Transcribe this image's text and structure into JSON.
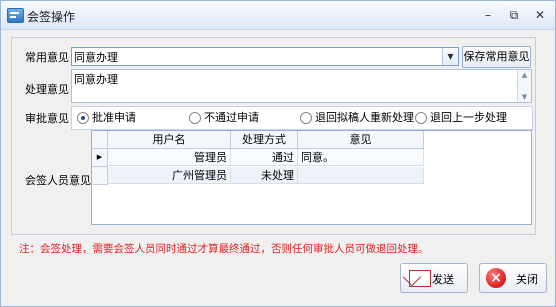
{
  "window": {
    "title": "会签操作",
    "buttons": {
      "minimize": "–",
      "restore": "⧉",
      "close": "✕"
    }
  },
  "form": {
    "common_opinion_label": "常用意见",
    "common_opinion_value": "同意办理",
    "save_common_label": "保存常用意见",
    "process_opinion_label": "处理意见",
    "process_opinion_value": "同意办理",
    "approve_opinion_label": "审批意见",
    "radio_options": [
      {
        "label": "批准申请",
        "checked": true
      },
      {
        "label": "不通过申请",
        "checked": false
      },
      {
        "label": "退回拟稿人重新处理",
        "checked": false
      },
      {
        "label": "退回上一步处理",
        "checked": false
      }
    ],
    "countersign_label": "会签人员意见"
  },
  "grid": {
    "columns": [
      "用户名",
      "处理方式",
      "意见"
    ],
    "rows": [
      {
        "current": true,
        "user": "管理员",
        "method": "通过",
        "opinion": "同意。"
      },
      {
        "current": false,
        "user": "广州管理员",
        "method": "未处理",
        "opinion": ""
      }
    ]
  },
  "note": "注：会签处理，需要会签人员同时通过才算最终通过，否则任何审批人员可做退回处理。",
  "actions": {
    "send": "发送",
    "close": "关闭"
  },
  "icons": {
    "app": "form-icon",
    "dropdown": "chevron-down-icon",
    "send": "mail-icon",
    "close": "close-icon"
  },
  "colors": {
    "note": "#e02323",
    "accent": "#2b78c9"
  }
}
